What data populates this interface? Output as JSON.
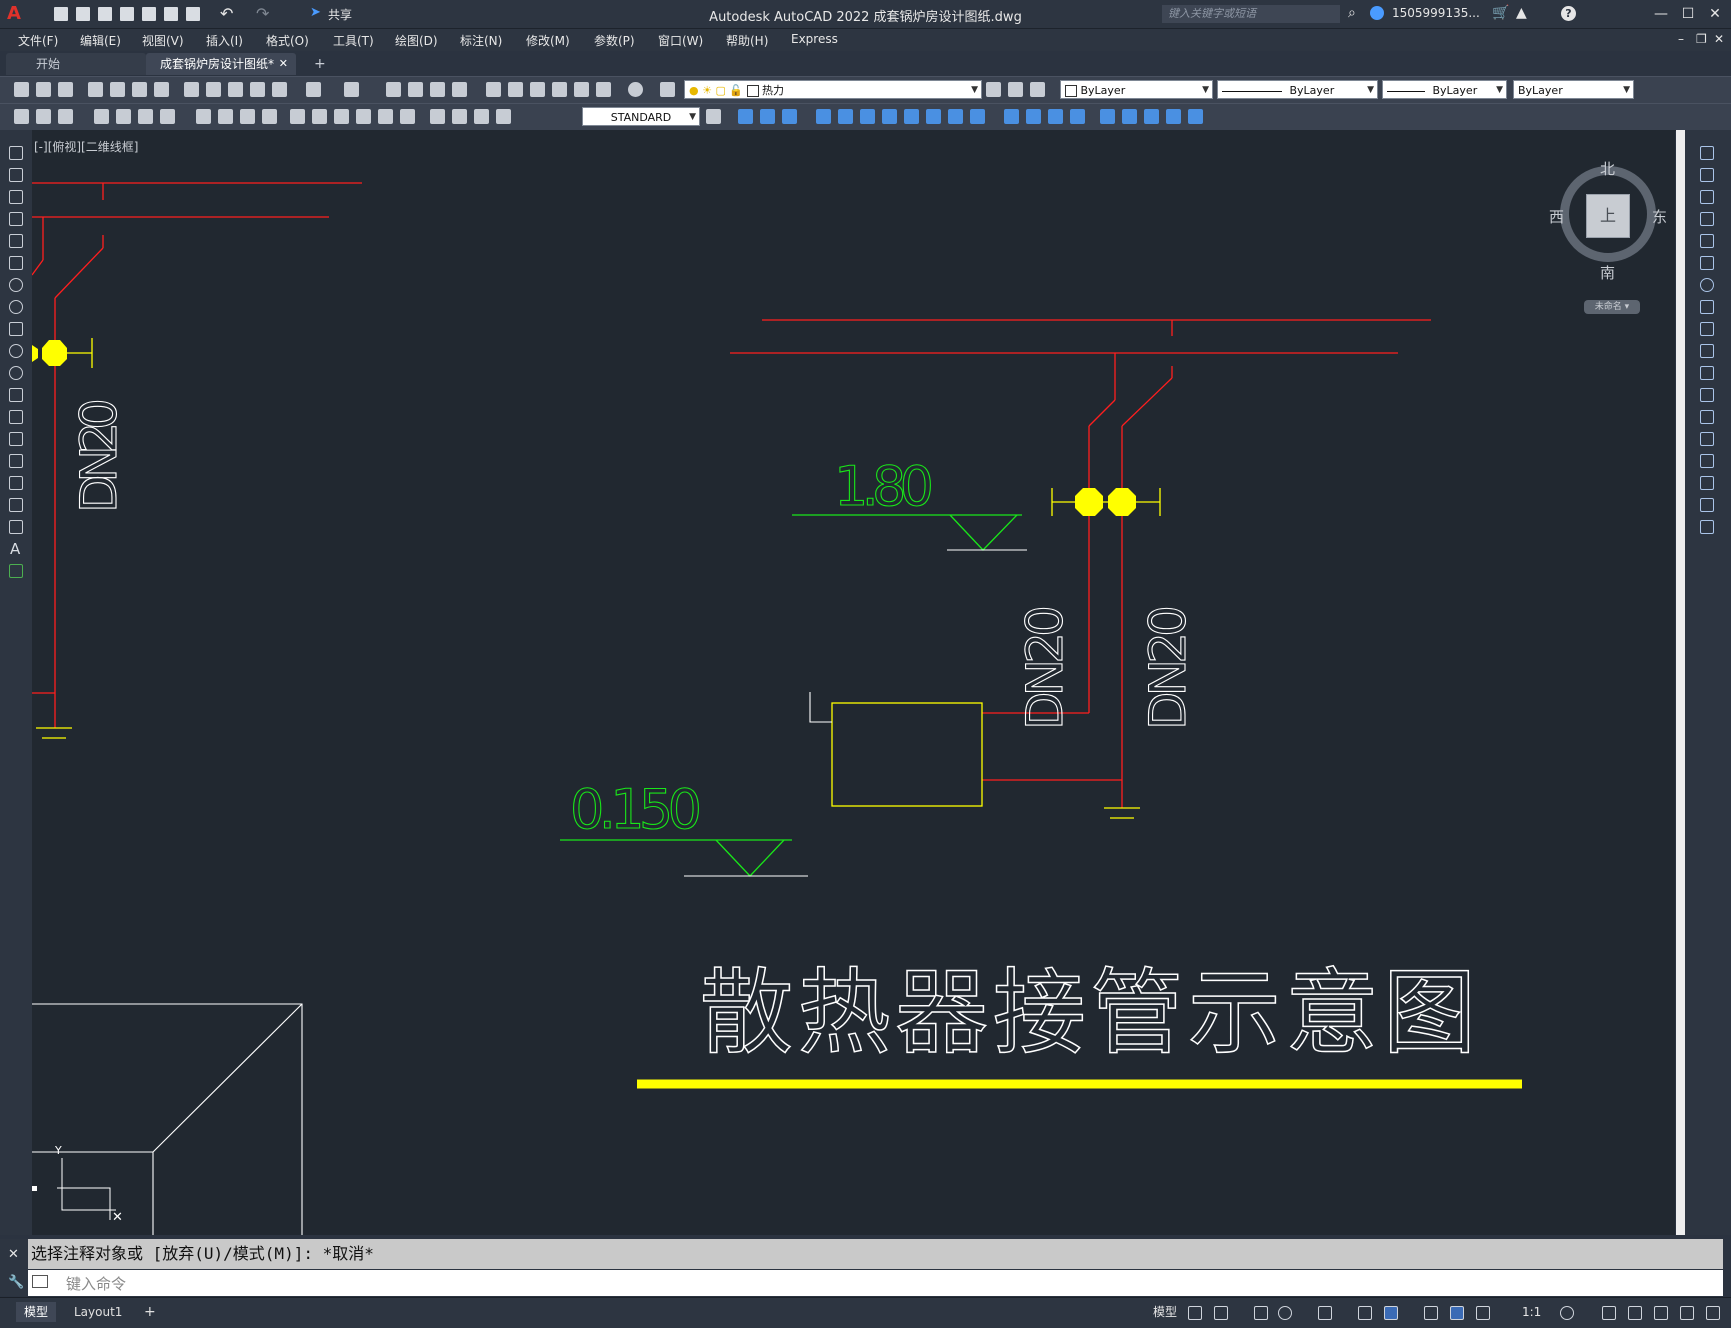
{
  "app": {
    "window_title": "Autodesk AutoCAD 2022    成套锅炉房设计图纸.dwg",
    "share_label": "共享",
    "search_placeholder": "键入关键字或短语",
    "user_name": "1505999135...",
    "win_minimize": "—",
    "win_maximize": "☐",
    "win_close": "✕"
  },
  "menu": [
    "文件(F)",
    "编辑(E)",
    "视图(V)",
    "插入(I)",
    "格式(O)",
    "工具(T)",
    "绘图(D)",
    "标注(N)",
    "修改(M)",
    "参数(P)",
    "窗口(W)",
    "帮助(H)",
    "Express"
  ],
  "tabs": {
    "start": "开始",
    "file": "成套锅炉房设计图纸*",
    "close": "✕",
    "new": "+"
  },
  "toolbar": {
    "layer_name": "热力",
    "color": "ByLayer",
    "linetype": "ByLayer",
    "lineweight": "ByLayer",
    "plotstyle": "ByLayer",
    "text_style": "STANDARD"
  },
  "viewport": {
    "label": "[-][俯视][二维线框]",
    "viewcube": {
      "north": "北",
      "south": "南",
      "east": "东",
      "west": "西",
      "top": "上",
      "ucs": "未命名 ▾"
    }
  },
  "drawing": {
    "pipe_labels": [
      "DN20",
      "DN20",
      "DN20"
    ],
    "elev_1": "1.80",
    "elev_2": "0.150",
    "title": "散热器接管示意图"
  },
  "colors": {
    "pipe": "#ff1e1e",
    "valve": "#ffff00",
    "elevation": "#19e619",
    "text": "#ffffff",
    "canvas": "#212830"
  },
  "command": {
    "history": "选择注释对象或 [放弃(U)/模式(M)]: *取消*",
    "placeholder": "键入命令"
  },
  "status": {
    "model_tab": "模型",
    "layout_tab": "Layout1",
    "add_tab": "+",
    "model_btn": "模型",
    "scale": "1:1"
  }
}
